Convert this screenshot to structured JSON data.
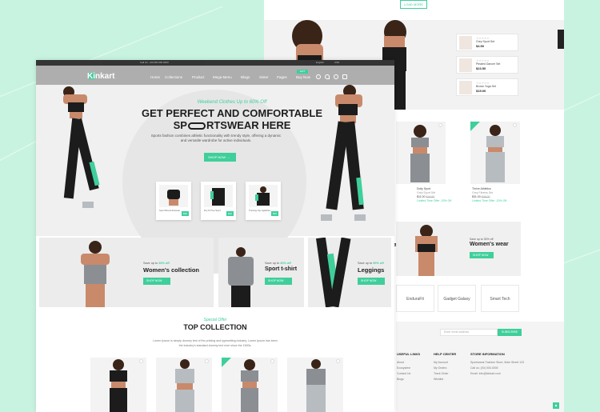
{
  "colors": {
    "accent": "#3fcf9b",
    "background": "#c9f3e1",
    "dark": "#1e1e1e"
  },
  "back_page": {
    "load_more": "LOAD MORE",
    "mini_products": [
      {
        "name": "Grey Sport Set",
        "price": "$4.50",
        "old": "$6.00"
      },
      {
        "name": "Pleated Dancer Set",
        "price": "$23.50",
        "old": "$35.00"
      },
      {
        "name": "Brown Yoga Set",
        "price": "$15.00"
      }
    ],
    "products": [
      {
        "name": "Dolly Sport",
        "sub": "Grey Sport Set",
        "price": "$11.00",
        "old": "$16.00",
        "note": "Limited Time Offer -20% Off"
      },
      {
        "name": "Thrive Athletics",
        "sub": "Grey Fitness Set",
        "price": "$31.00",
        "old": "$38.00",
        "note": "Limited Time Offer -20% Off"
      }
    ],
    "banner_womens": {
      "sub": "Save up to 30% off",
      "title": "Women's wear",
      "button": "SHOP NOW"
    },
    "banner_partial_title": "ar",
    "brands": [
      "EnduraFit",
      "Gadget Galaxy",
      "Smart Tech"
    ],
    "newsletter": {
      "placeholder": "Enter email address",
      "button": "SUBSCRIBE"
    },
    "footer": {
      "useful_links": {
        "title": "USEFUL LINKS",
        "items": [
          "About",
          "Ecosystem",
          "Contact Us",
          "Blogs"
        ]
      },
      "help_center": {
        "title": "HELP CENTER",
        "items": [
          "My Account",
          "My Orders",
          "Track Order",
          "Wishlist"
        ]
      },
      "store_info": {
        "title": "STORE INFORMATION",
        "items": [
          "Sportswear Fashion Store, Main Street 123",
          "Call us: (00) 000-0000",
          "Email: info@kinkart.com"
        ]
      }
    }
  },
  "front_page": {
    "topbar": {
      "left": "Call Us: +00 000 000 0000",
      "right_lang": "English",
      "right_cur": "USD"
    },
    "logo": "Kinkart",
    "nav": [
      "Home",
      "Collections",
      "Product",
      "Mega Menu",
      "Blogs",
      "Sister",
      "Pages",
      "Buy Now"
    ],
    "hot_badge": "HOT",
    "hero": {
      "subtitle": "Weekend Clothes Up to 60% Off",
      "title_line1": "GET PERFECT AND COMFORTABLE",
      "title_pre": "SP",
      "title_post": "RTSWEAR HERE",
      "description": "Sports fashion combines athletic functionality with trendy style, offering a dynamic and versatile wardrobe for active individuals.",
      "button": "SHOP NOW"
    },
    "hero_products": [
      {
        "name": "Sport Bra Activewear",
        "price": "$30"
      },
      {
        "name": "Dry Fit Tee Sport",
        "price": "$40"
      },
      {
        "name": "Training Top AgileFlex",
        "price": "$35"
      }
    ],
    "categories": [
      {
        "sub_pre": "Save up to",
        "sub_val": "30% off",
        "title": "Women's collection",
        "button": "SHOP NOW"
      },
      {
        "sub_pre": "Save up to",
        "sub_val": "40% off",
        "title": "Sport t-shirt",
        "button": "SHOP NOW"
      },
      {
        "sub_pre": "Save up to",
        "sub_val": "50% off",
        "title": "Leggings",
        "button": "SHOP NOW"
      }
    ],
    "collection": {
      "subtitle": "Special Offer",
      "title": "TOP COLLECTION",
      "description": "Lorem Ipsum is simply dummy text of the printing and typesetting industry. Lorem Ipsum has been the industry's standard dummy text ever since the 1500s."
    }
  }
}
